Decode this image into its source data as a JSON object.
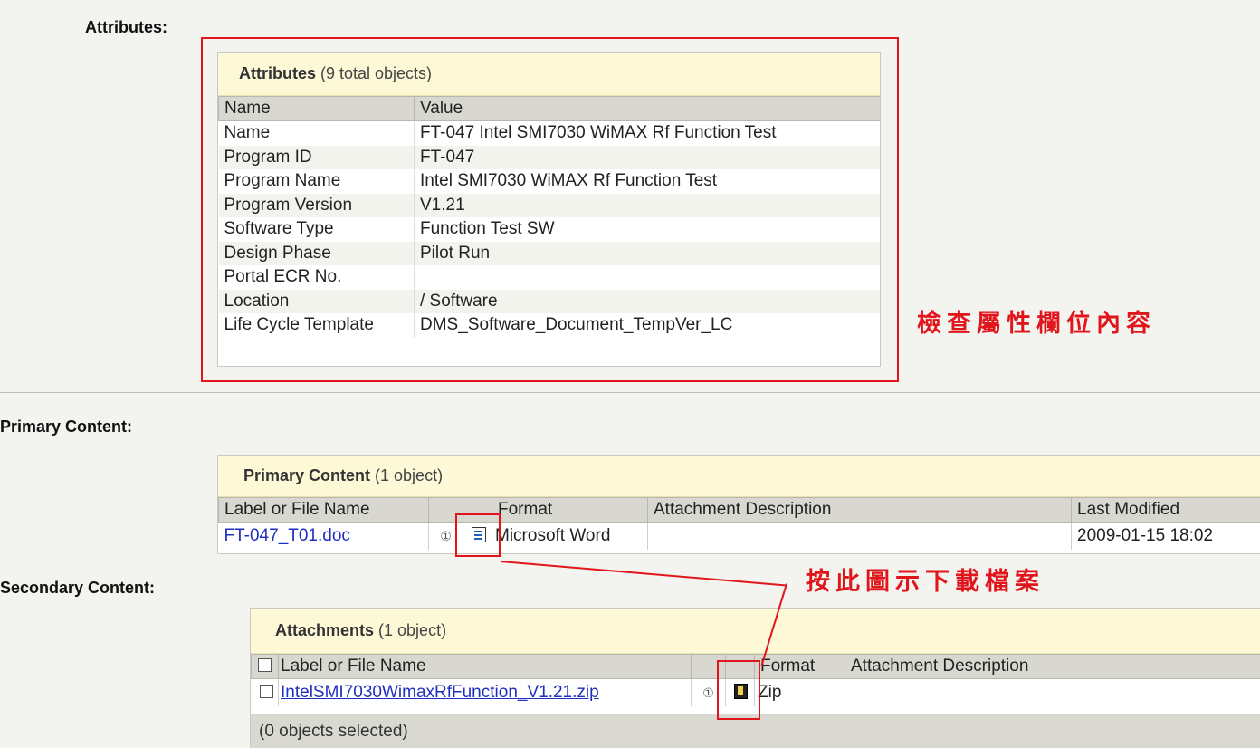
{
  "sections": {
    "attributes_label": "Attributes:",
    "primary_label": "Primary Content:",
    "secondary_label": "Secondary Content:"
  },
  "attributes_panel": {
    "title": "Attributes",
    "count": "(9 total objects)",
    "columns": [
      "Name",
      "Value"
    ],
    "rows": [
      {
        "name": "Name",
        "value": "FT-047 Intel SMI7030 WiMAX Rf Function Test"
      },
      {
        "name": "Program ID",
        "value": "FT-047"
      },
      {
        "name": "Program Name",
        "value": "Intel SMI7030 WiMAX Rf Function Test"
      },
      {
        "name": "Program Version",
        "value": "V1.21"
      },
      {
        "name": "Software Type",
        "value": "Function Test SW"
      },
      {
        "name": "Design Phase",
        "value": "Pilot Run"
      },
      {
        "name": "Portal ECR No.",
        "value": ""
      },
      {
        "name": "Location",
        "value": "/ Software"
      },
      {
        "name": "Life Cycle Template",
        "value": "DMS_Software_Document_TempVer_LC"
      }
    ]
  },
  "primary_panel": {
    "title": "Primary Content",
    "count": "(1 object)",
    "columns": {
      "label": "Label or File Name",
      "format": "Format",
      "description": "Attachment Description",
      "modified": "Last Modified"
    },
    "row": {
      "file": "FT-047_T01.doc",
      "info": "①",
      "format": "Microsoft Word",
      "description": "",
      "modified": "2009-01-15 18:02"
    }
  },
  "attachments_panel": {
    "title": "Attachments",
    "count": "(1 object)",
    "columns": {
      "label": "Label or File Name",
      "format": "Format",
      "description": "Attachment Description"
    },
    "row": {
      "file": "IntelSMI7030WimaxRfFunction_V1.21.zip",
      "info": "①",
      "format": "Zip",
      "description": ""
    },
    "footer": "(0 objects selected)"
  },
  "annotations": {
    "check_attributes": "檢查屬性欄位內容",
    "click_icon_download": "按此圖示下載檔案",
    "color": "#e0161c"
  },
  "icons": {
    "info": "info-icon",
    "word_doc": "word-document-icon",
    "zip": "zip-archive-icon"
  }
}
